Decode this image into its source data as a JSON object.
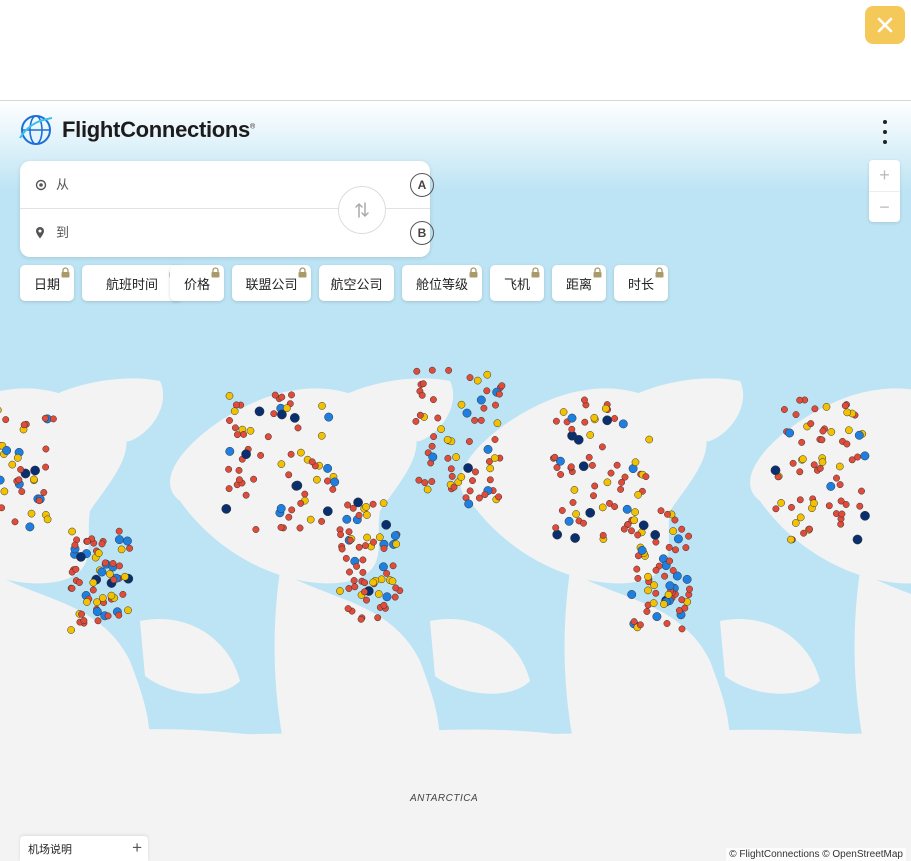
{
  "brand": {
    "name": "FlightConnections",
    "registered": "®"
  },
  "search": {
    "from_placeholder": "从",
    "to_placeholder": "到",
    "badge_a": "A",
    "badge_b": "B"
  },
  "filters": [
    {
      "label": "日期",
      "locked": true
    },
    {
      "label": "航班时间",
      "locked": true
    },
    {
      "label": "价格",
      "locked": true
    },
    {
      "label": "联盟公司",
      "locked": true
    },
    {
      "label": "航空公司",
      "locked": false
    },
    {
      "label": "舱位等级",
      "locked": true
    },
    {
      "label": "飞机",
      "locked": true
    },
    {
      "label": "距离",
      "locked": true
    },
    {
      "label": "时长",
      "locked": true
    }
  ],
  "zoom": {
    "in": "+",
    "out": "−"
  },
  "map": {
    "label_antarctica": "ANTARCTICA",
    "attribution": "© FlightConnections © OpenStreetMap"
  },
  "legend": {
    "label": "机场说明",
    "expand": "+"
  },
  "colors": {
    "accent": "#f5c85a",
    "ocean": "#bde4f4",
    "land": "#f3f3f3",
    "airport_small": "#e04b3a",
    "airport_medium": "#f2c200",
    "airport_large": "#1e7fe0",
    "airport_hub": "#0a2f6e"
  },
  "icons": {
    "close": "close-icon",
    "menu": "more-vert-icon",
    "from": "target-icon",
    "to": "pin-icon",
    "swap": "swap-vertical-icon",
    "lock": "lock-icon",
    "legend_expand": "plus-icon"
  }
}
